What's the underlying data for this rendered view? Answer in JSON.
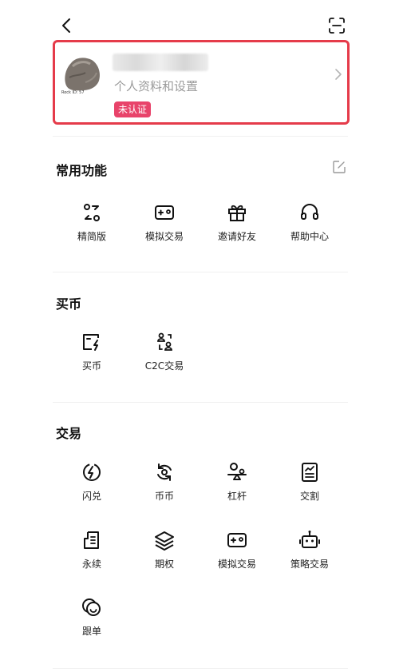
{
  "profile": {
    "avatar_id": "Rock ID: 57",
    "subtitle": "个人资料和设置",
    "badge": "未认证"
  },
  "sections": {
    "common": {
      "title": "常用功能",
      "items": [
        "精简版",
        "模拟交易",
        "邀请好友",
        "帮助中心"
      ]
    },
    "buy": {
      "title": "买币",
      "items": [
        "买币",
        "C2C交易"
      ]
    },
    "trade": {
      "title": "交易",
      "items": [
        "闪兑",
        "币币",
        "杠杆",
        "交割",
        "永续",
        "期权",
        "模拟交易",
        "策略交易",
        "跟单"
      ]
    }
  },
  "colors": {
    "highlight_border": "#e53b4a",
    "badge": "#e8436a"
  }
}
